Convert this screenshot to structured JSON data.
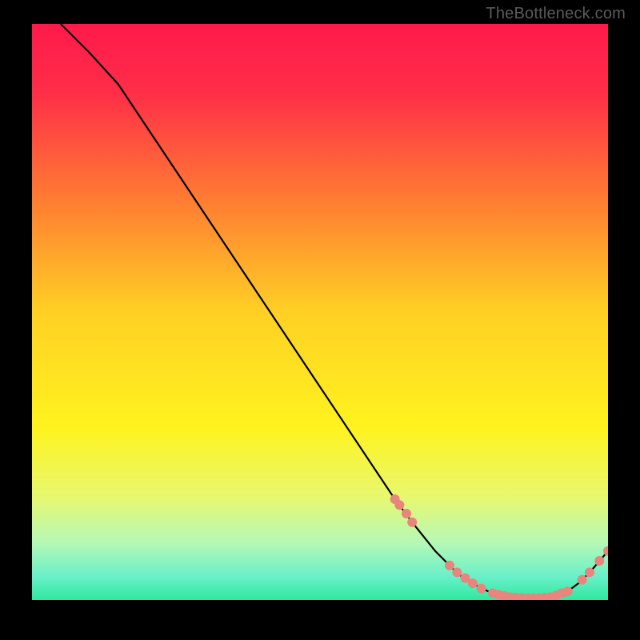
{
  "watermark": "TheBottleneck.com",
  "annotation_label": "",
  "chart_data": {
    "type": "line",
    "title": "",
    "xlabel": "",
    "ylabel": "",
    "xlim": [
      0,
      100
    ],
    "ylim": [
      0,
      100
    ],
    "background_gradient": {
      "stops": [
        {
          "offset": 0.0,
          "color": "#ff1a4a"
        },
        {
          "offset": 0.12,
          "color": "#ff2e48"
        },
        {
          "offset": 0.3,
          "color": "#ff7a33"
        },
        {
          "offset": 0.5,
          "color": "#ffd024"
        },
        {
          "offset": 0.7,
          "color": "#fff31e"
        },
        {
          "offset": 0.82,
          "color": "#e8f86e"
        },
        {
          "offset": 0.9,
          "color": "#b6f8b6"
        },
        {
          "offset": 0.96,
          "color": "#68f0c8"
        },
        {
          "offset": 1.0,
          "color": "#2fe8a0"
        }
      ]
    },
    "series": [
      {
        "name": "bottleneck-curve",
        "color": "#000000",
        "x": [
          5,
          10,
          15,
          20,
          25,
          30,
          35,
          40,
          45,
          50,
          55,
          60,
          63,
          66,
          70,
          74,
          78,
          80,
          82,
          84,
          86,
          88,
          90,
          93,
          95,
          97,
          100
        ],
        "y": [
          100,
          95,
          89.5,
          82,
          74.5,
          67,
          59.5,
          52,
          44.5,
          37,
          29.5,
          22,
          17.5,
          13.5,
          8.5,
          4.5,
          2.0,
          1.2,
          0.7,
          0.4,
          0.3,
          0.3,
          0.5,
          1.5,
          3.0,
          5.0,
          8.5
        ]
      }
    ],
    "markers": [
      {
        "name": "segment-markers",
        "color": "#e8857c",
        "radius": 6,
        "points": [
          {
            "x": 63.0,
            "y": 17.5
          },
          {
            "x": 63.8,
            "y": 16.5
          },
          {
            "x": 65.0,
            "y": 15.0
          },
          {
            "x": 66.0,
            "y": 13.5
          },
          {
            "x": 72.5,
            "y": 6.0
          },
          {
            "x": 73.8,
            "y": 4.8
          },
          {
            "x": 75.2,
            "y": 3.8
          },
          {
            "x": 76.5,
            "y": 2.9
          },
          {
            "x": 78.0,
            "y": 2.0
          },
          {
            "x": 80.0,
            "y": 1.2
          },
          {
            "x": 81.0,
            "y": 0.9
          },
          {
            "x": 82.0,
            "y": 0.7
          },
          {
            "x": 83.0,
            "y": 0.5
          },
          {
            "x": 84.0,
            "y": 0.4
          },
          {
            "x": 85.0,
            "y": 0.35
          },
          {
            "x": 86.0,
            "y": 0.3
          },
          {
            "x": 87.0,
            "y": 0.3
          },
          {
            "x": 88.0,
            "y": 0.3
          },
          {
            "x": 89.0,
            "y": 0.4
          },
          {
            "x": 90.0,
            "y": 0.5
          },
          {
            "x": 91.0,
            "y": 0.8
          },
          {
            "x": 92.0,
            "y": 1.2
          },
          {
            "x": 93.0,
            "y": 1.5
          },
          {
            "x": 95.5,
            "y": 3.5
          },
          {
            "x": 96.8,
            "y": 4.8
          },
          {
            "x": 98.5,
            "y": 6.8
          },
          {
            "x": 100.0,
            "y": 8.5
          }
        ]
      }
    ]
  }
}
